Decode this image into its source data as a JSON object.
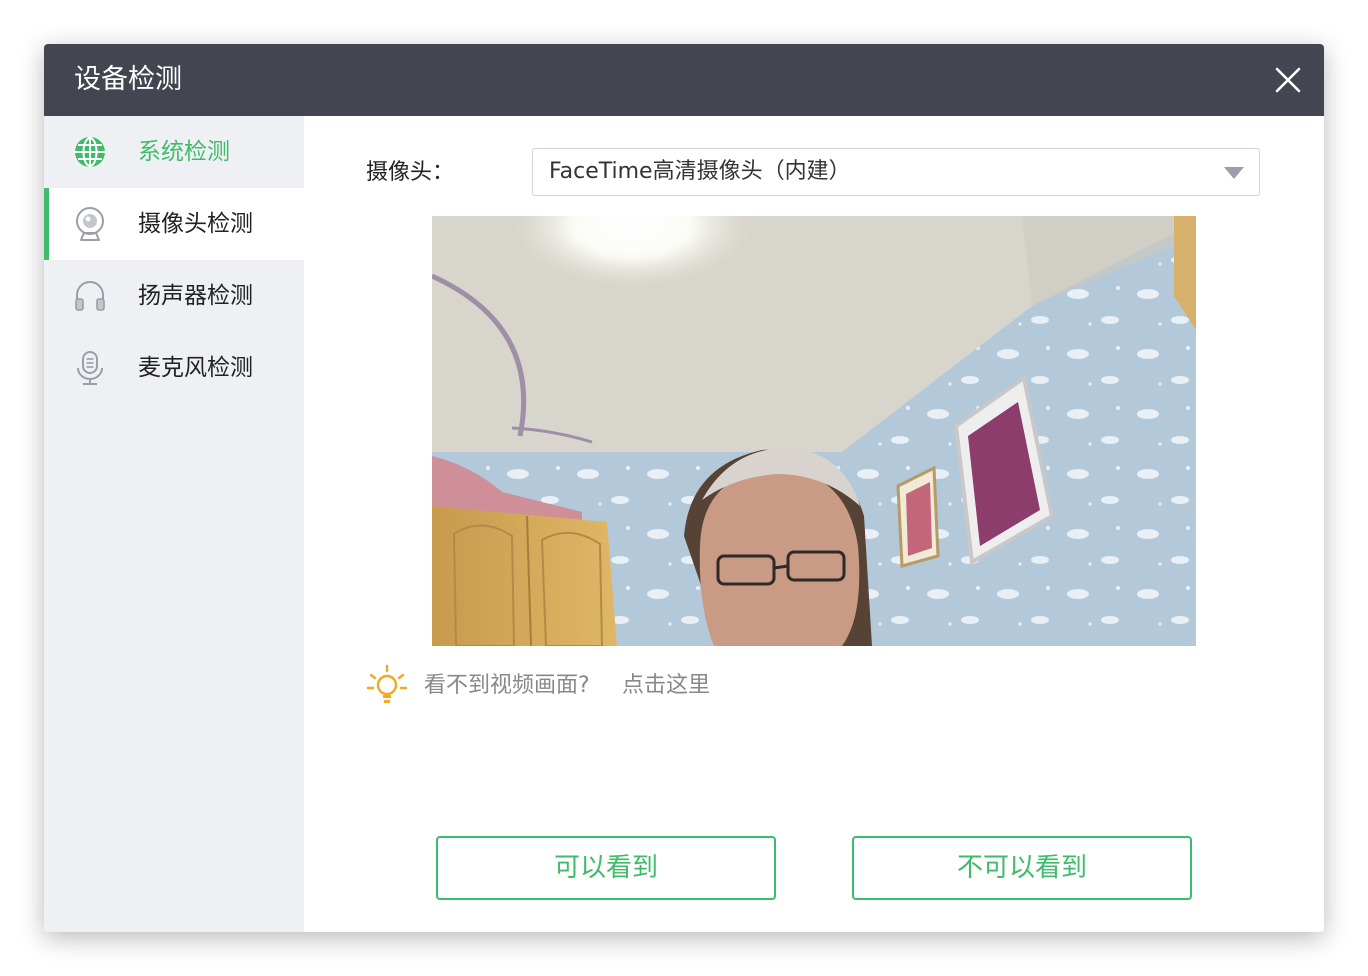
{
  "dialog": {
    "title": "设备检测",
    "close_icon": "close-icon"
  },
  "sidebar": {
    "items": [
      {
        "label": "系统检测",
        "icon": "globe-icon",
        "state": "completed"
      },
      {
        "label": "摄像头检测",
        "icon": "webcam-icon",
        "state": "selected"
      },
      {
        "label": "扬声器检测",
        "icon": "headphones-icon",
        "state": "pending"
      },
      {
        "label": "麦克风检测",
        "icon": "microphone-icon",
        "state": "pending"
      }
    ]
  },
  "camera": {
    "label": "摄像头：",
    "selected_device": "FaceTime高清摄像头（内建）",
    "dropdown_icon": "caret-down-icon"
  },
  "hint": {
    "icon": "lightbulb-icon",
    "text": "看不到视频画面?",
    "link": "点击这里"
  },
  "actions": {
    "can_see": "可以看到",
    "cannot_see": "不可以看到"
  },
  "colors": {
    "titlebar": "#434550",
    "accent_green": "#3fbc6a",
    "sidebar_bg": "#eff0f4",
    "hint_icon": "#f5a623"
  }
}
